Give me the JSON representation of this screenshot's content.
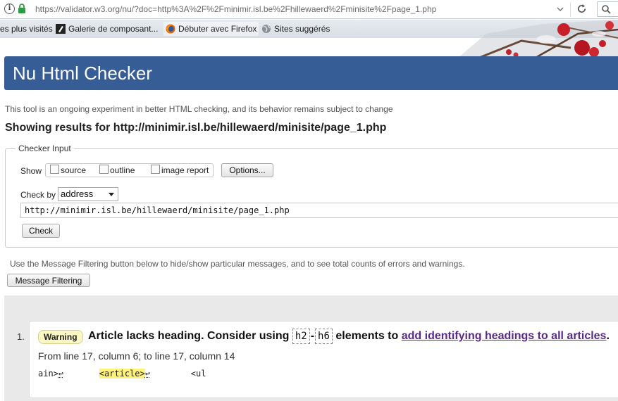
{
  "browser": {
    "url": "https://validator.w3.org/nu/?doc=http%3A%2F%2Fminimir.isl.be%2Fhillewaerd%2Fminisite%2Fpage_1.php",
    "bookmarks": [
      {
        "label": "es plus visités"
      },
      {
        "label": "Galerie de composant..."
      },
      {
        "label": "Débuter avec Firefox"
      },
      {
        "label": "Sites suggérés"
      }
    ]
  },
  "page": {
    "title": "Nu Html Checker",
    "intro": "This tool is an ongoing experiment in better HTML checking, and its behavior remains subject to change",
    "results_heading": "Showing results for http://minimir.isl.be/hillewaerd/minisite/page_1.php"
  },
  "checker_input": {
    "legend": "Checker Input",
    "show_label": "Show",
    "options": [
      {
        "label": "source",
        "checked": false
      },
      {
        "label": "outline",
        "checked": false
      },
      {
        "label": "image report",
        "checked": false
      }
    ],
    "options_button": "Options...",
    "check_by_label": "Check by",
    "check_by_value": "address",
    "address_value": "http://minimir.isl.be/hillewaerd/minisite/page_1.php",
    "check_button": "Check"
  },
  "filter": {
    "note": "Use the Message Filtering button below to hide/show particular messages, and to see total counts of errors and warnings.",
    "button": "Message Filtering"
  },
  "messages": [
    {
      "number": "1.",
      "type": "Warning",
      "text_before": "Article lacks heading. Consider using",
      "code_start": "h2",
      "dash": "-",
      "code_end": "h6",
      "text_middle": "elements to",
      "link": "add identifying headings to all articles",
      "text_after": ".",
      "location": "From line 17, column 6; to line 17, column 14",
      "extract_before": "ain>",
      "extract_return": "↩",
      "extract_highlight": "<article>",
      "extract_after": "<ul"
    }
  ],
  "colors": {
    "header": "#365d95",
    "warning_badge": "#fbf7c4",
    "highlight": "#fff27a",
    "link": "#5a2a88"
  }
}
